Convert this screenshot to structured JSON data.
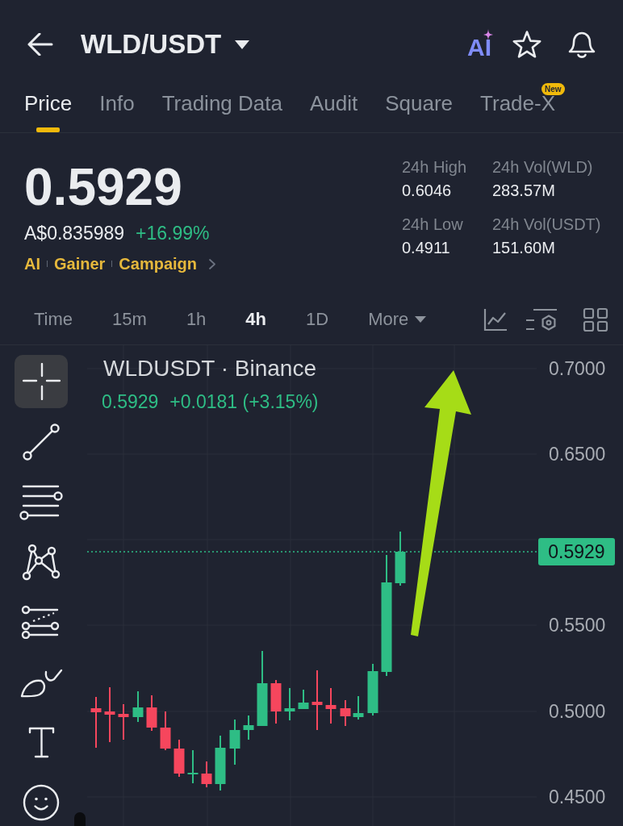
{
  "header": {
    "title": "WLD/USDT",
    "ai_label": "AI"
  },
  "tabs": [
    {
      "label": "Price",
      "selected": true
    },
    {
      "label": "Info",
      "selected": false
    },
    {
      "label": "Trading Data",
      "selected": false
    },
    {
      "label": "Audit",
      "selected": false
    },
    {
      "label": "Square",
      "selected": false
    },
    {
      "label": "Trade-X",
      "selected": false,
      "badge": "New"
    }
  ],
  "price": {
    "last": "0.5929",
    "fiat": "A$0.835989",
    "change": "+16.99%",
    "tags": [
      "AI",
      "Gainer",
      "Campaign"
    ]
  },
  "stats": [
    {
      "label": "24h High",
      "value": "0.6046"
    },
    {
      "label": "24h Vol(WLD)",
      "value": "283.57M"
    },
    {
      "label": "24h Low",
      "value": "0.4911"
    },
    {
      "label": "24h Vol(USDT)",
      "value": "151.60M"
    }
  ],
  "intervals": [
    {
      "label": "Time",
      "kind": "interval",
      "selected": false
    },
    {
      "label": "15m",
      "kind": "interval",
      "selected": false
    },
    {
      "label": "1h",
      "kind": "interval",
      "selected": false
    },
    {
      "label": "4h",
      "kind": "interval",
      "selected": true
    },
    {
      "label": "1D",
      "kind": "interval",
      "selected": false
    },
    {
      "label": "More",
      "kind": "menu",
      "selected": false
    }
  ],
  "drawing_tools": [
    {
      "kind": "crosshair",
      "selected": true
    },
    {
      "kind": "trendline",
      "selected": false
    },
    {
      "kind": "levels",
      "selected": false
    },
    {
      "kind": "pattern",
      "selected": false
    },
    {
      "kind": "fibonacci",
      "selected": false
    },
    {
      "kind": "brush",
      "selected": false
    },
    {
      "kind": "text",
      "selected": false
    },
    {
      "kind": "emoji",
      "selected": false
    }
  ],
  "chart": {
    "title": "WLDUSDT · Binance",
    "last": "0.5929",
    "change": "+0.0181 (+3.15%)",
    "price_scale": [
      "0.7000",
      "0.6500",
      "0.5500",
      "0.5000",
      "0.4500"
    ],
    "last_price_tag": "0.5929"
  }
}
